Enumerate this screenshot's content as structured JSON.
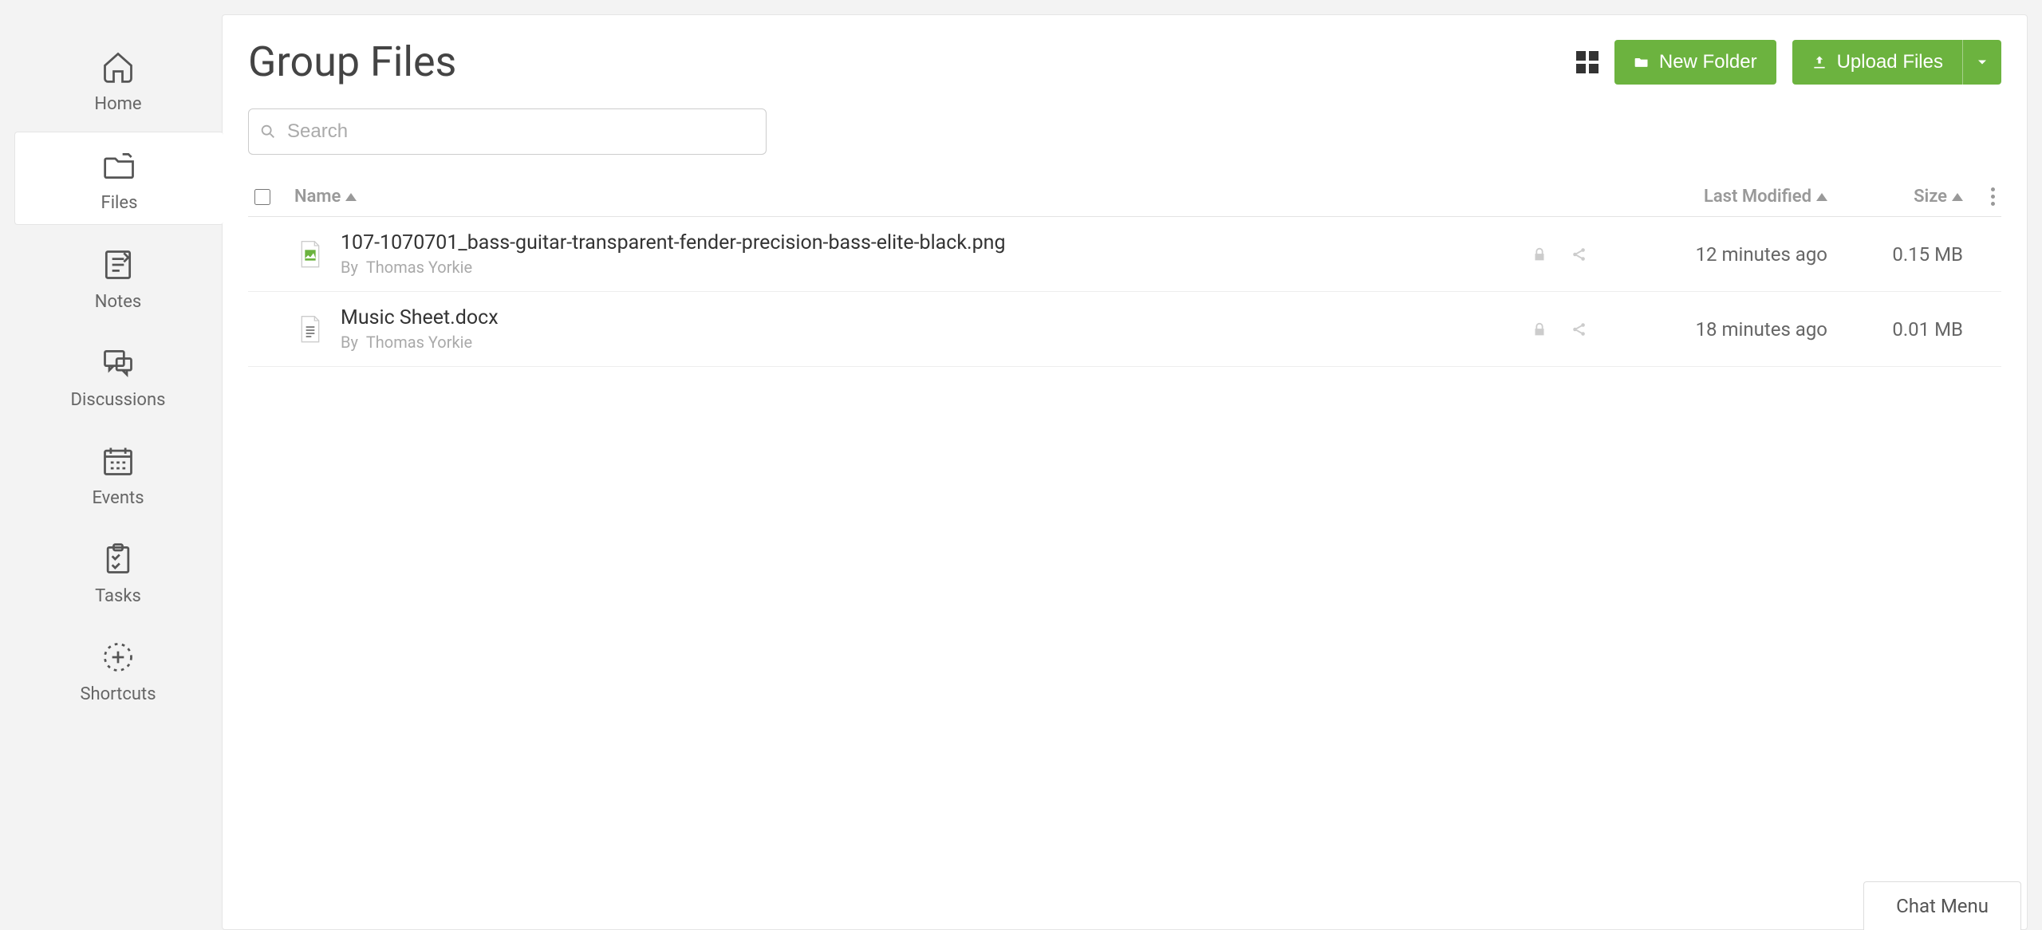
{
  "sidebar": {
    "items": [
      {
        "label": "Home",
        "icon": "home-icon"
      },
      {
        "label": "Files",
        "icon": "files-icon"
      },
      {
        "label": "Notes",
        "icon": "notes-icon"
      },
      {
        "label": "Discussions",
        "icon": "discussions-icon"
      },
      {
        "label": "Events",
        "icon": "events-icon"
      },
      {
        "label": "Tasks",
        "icon": "tasks-icon"
      },
      {
        "label": "Shortcuts",
        "icon": "shortcuts-icon"
      }
    ],
    "active_index": 1
  },
  "page": {
    "title": "Group Files"
  },
  "actions": {
    "new_folder_label": "New Folder",
    "upload_files_label": "Upload Files"
  },
  "search": {
    "placeholder": "Search",
    "value": ""
  },
  "columns": {
    "name": "Name",
    "last_modified": "Last Modified",
    "size": "Size"
  },
  "files": [
    {
      "name": "107-1070701_bass-guitar-transparent-fender-precision-bass-elite-black.png",
      "by_prefix": "By",
      "by": "Thomas Yorkie",
      "modified": "12 minutes ago",
      "size": "0.15 MB",
      "type": "image"
    },
    {
      "name": "Music Sheet.docx",
      "by_prefix": "By",
      "by": "Thomas Yorkie",
      "modified": "18 minutes ago",
      "size": "0.01 MB",
      "type": "doc"
    }
  ],
  "chat_menu": {
    "label": "Chat Menu"
  },
  "colors": {
    "primary_green": "#6cb33f"
  }
}
